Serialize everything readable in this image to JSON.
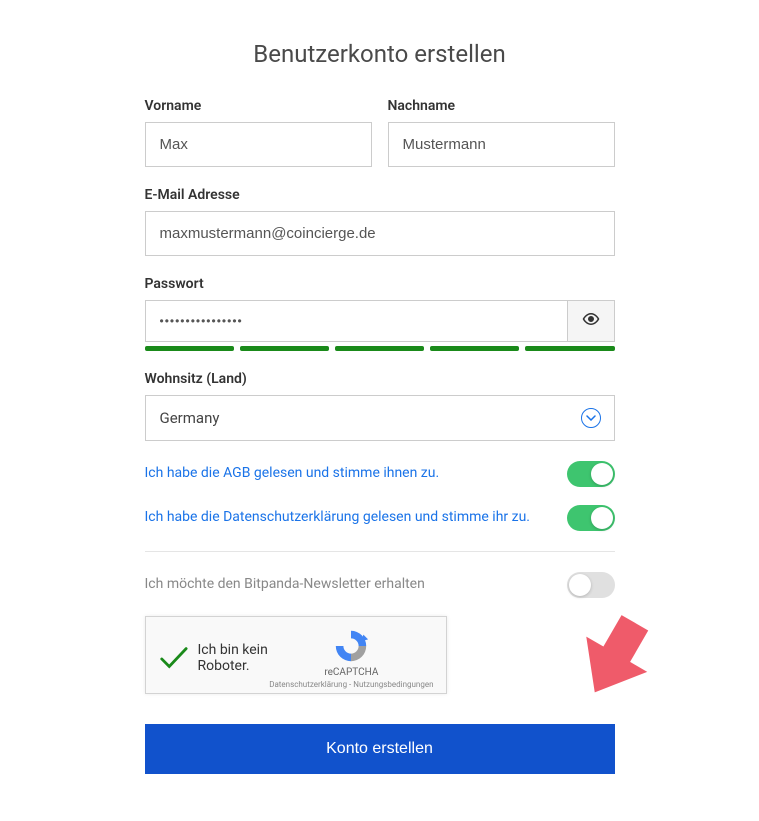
{
  "title": "Benutzerkonto erstellen",
  "fields": {
    "firstname": {
      "label": "Vorname",
      "value": "Max"
    },
    "lastname": {
      "label": "Nachname",
      "value": "Mustermann"
    },
    "email": {
      "label": "E-Mail Adresse",
      "value": "maxmustermann@coincierge.de"
    },
    "password": {
      "label": "Passwort",
      "value": "••••••••••••••••"
    },
    "country": {
      "label": "Wohnsitz (Land)",
      "value": "Germany"
    }
  },
  "toggles": {
    "agb": {
      "label": "Ich habe die AGB gelesen und stimme ihnen zu.",
      "on": true
    },
    "privacy": {
      "label": "Ich habe die Datenschutzerklärung gelesen und stimme ihr zu.",
      "on": true
    },
    "newsletter": {
      "label": "Ich möchte den Bitpanda-Newsletter erhalten",
      "on": false
    }
  },
  "recaptcha": {
    "text": "Ich bin kein Roboter.",
    "brand": "reCAPTCHA",
    "links": "Datenschutzerklärung - Nutzungsbedingungen"
  },
  "submit": "Konto erstellen"
}
